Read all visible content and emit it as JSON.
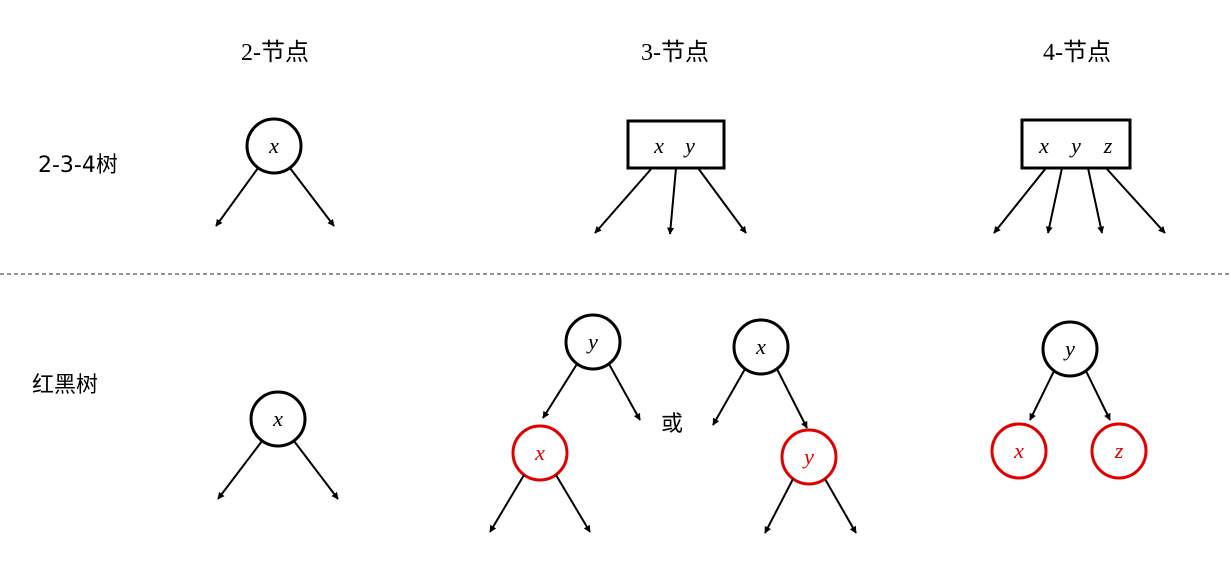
{
  "columns": {
    "two_node": "2-节点",
    "three_node": "3-节点",
    "four_node": "4-节点"
  },
  "rows": {
    "tree234": "2-3-4树",
    "rbtree": "红黑树"
  },
  "or_label": "或",
  "vars": {
    "x": "x",
    "y": "y",
    "z": "z"
  },
  "colors": {
    "black": "#000000",
    "red": "#e00000",
    "divider": "#555555"
  }
}
